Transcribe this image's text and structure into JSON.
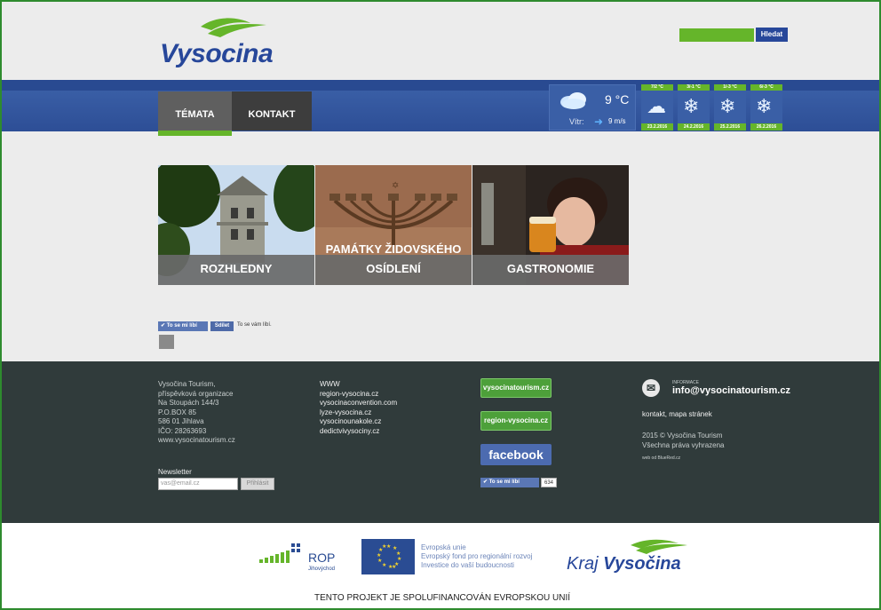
{
  "header": {
    "logo_text": "Vysocina",
    "search": {
      "placeholder": "",
      "button_label": "Hledat"
    }
  },
  "nav": {
    "tabs": [
      {
        "label": "TÉMATA"
      },
      {
        "label": "KONTAKT"
      }
    ]
  },
  "weather": {
    "temperature": "9 °C",
    "wind_label": "Vítr:",
    "wind_value": "9 m/s",
    "forecast": [
      {
        "temp": "7/2 °C",
        "date": "23.2.2016",
        "icon": "rain-cloud-icon"
      },
      {
        "temp": "3/-1 °C",
        "date": "24.2.2016",
        "icon": "snow-icon"
      },
      {
        "temp": "1/-3 °C",
        "date": "25.2.2016",
        "icon": "snow-icon"
      },
      {
        "temp": "6/-3 °C",
        "date": "26.2.2016",
        "icon": "snow-icon"
      }
    ]
  },
  "tiles": [
    {
      "label_line1": "ROZHLEDNY",
      "label_line2": ""
    },
    {
      "label_line1": "PAMÁTKY ŽIDOVSKÉHO",
      "label_line2": "OSÍDLENÍ"
    },
    {
      "label_line1": "GASTRONOMIE",
      "label_line2": ""
    }
  ],
  "social": {
    "like_label": "To se mi líbí",
    "share_label": "Sdílet",
    "like_text": "To se vám líbí."
  },
  "footer": {
    "org": {
      "name": "Vysočina Tourism,",
      "lines": [
        "příspěvková organizace",
        "Na Stoupách 144/3",
        "P.O.BOX 85",
        "586 01 Jihlava",
        "IČO: 28263693"
      ],
      "website": "www.vysocinatourism.cz"
    },
    "www": {
      "heading": "WWW",
      "links": [
        "region-vysocina.cz",
        "vysocinaconvention.com",
        "lyze-vysocina.cz",
        "vysocinounakole.cz",
        "dedictvivysociny.cz"
      ]
    },
    "newsletter": {
      "label": "Newsletter",
      "placeholder": "vas@email.cz",
      "button_label": "Přihlásit"
    },
    "badges": {
      "tourism": "vysocinatourism.cz",
      "region": "region-vysocina.cz",
      "facebook": "facebook",
      "like_label": "To se mi líbí",
      "like_count": "634"
    },
    "info": {
      "label": "INFORMACE",
      "email": "info@vysocinatourism.cz",
      "links": "kontakt, mapa stránek",
      "copyright_1": "2015 © Vysočina Tourism",
      "copyright_2": "Všechna práva vyhrazena",
      "web_by": "web od BlueRed.cz"
    }
  },
  "sponsors": {
    "rop": "ROP",
    "rop_sub": "Jihovýchod",
    "eu_lines": [
      "Evropská unie",
      "Evropský fond pro regionální rozvoj",
      "Investice do vaší budoucnosti"
    ],
    "kraj_1": "Kraj",
    "kraj_2": "Vysočina",
    "cofund": "TENTO PROJEKT JE SPOLUFINANCOVÁN EVROPSKOU UNIÍ"
  },
  "colors": {
    "brand_blue": "#27479a",
    "brand_green": "#65b52a",
    "footer_bg": "#303b3b"
  }
}
